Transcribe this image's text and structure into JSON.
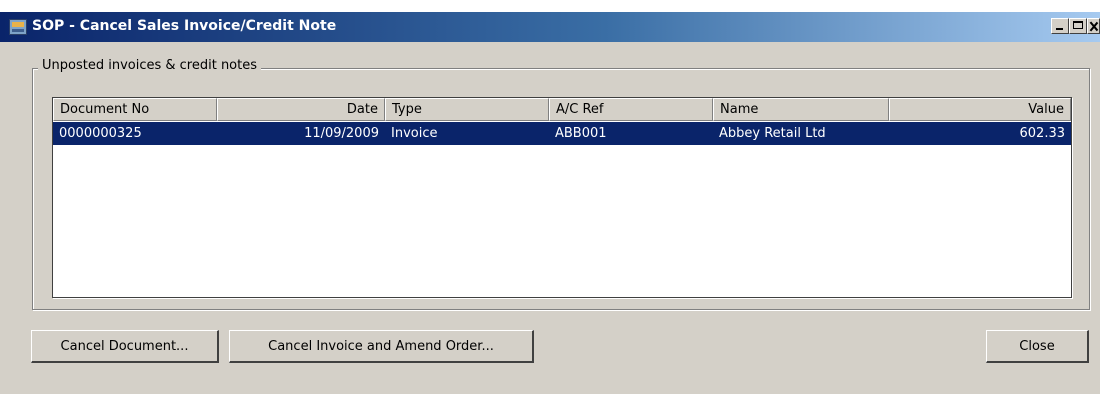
{
  "window": {
    "title": "SOP - Cancel Sales Invoice/Credit Note",
    "icon": "sage-app-icon",
    "caption_buttons": [
      "minimize-icon",
      "maximize-icon",
      "close-icon"
    ]
  },
  "group": {
    "label": "Unposted invoices & credit notes"
  },
  "table": {
    "columns": [
      "Document No",
      "Date",
      "Type",
      "A/C Ref",
      "Name",
      "Value"
    ],
    "rows": [
      {
        "document_no": "0000000325",
        "date": "11/09/2009",
        "type": "Invoice",
        "ac_ref": "ABB001",
        "name": "Abbey Retail Ltd",
        "value": "602.33",
        "selected": true
      }
    ]
  },
  "buttons": {
    "cancel_document": "Cancel Document...",
    "cancel_invoice_amend": "Cancel Invoice and Amend Order...",
    "close": "Close"
  },
  "colors": {
    "selection": "#0a246a",
    "window_bg": "#d4d0c8",
    "title_gradient_start": "#0a246a",
    "title_gradient_end": "#a6caf0"
  }
}
